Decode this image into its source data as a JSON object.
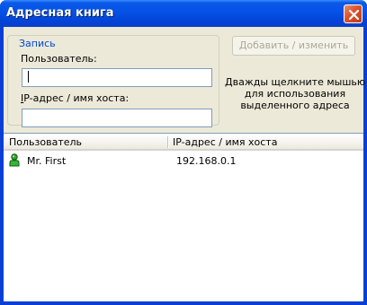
{
  "window": {
    "title": "Адресная книга"
  },
  "entry_group": {
    "legend": "Запись",
    "user_label": "Пользователь:",
    "ip_label_underlined": "I",
    "ip_label_rest": "P-адрес / имя хоста:",
    "user_value": "",
    "ip_value": ""
  },
  "add_button": {
    "label": "Добавить / изменить",
    "enabled": false
  },
  "hint": {
    "line1": "Дважды щелкните мышью",
    "line2": "для использования",
    "line3": "выделенного адреса"
  },
  "list": {
    "columns": [
      "Пользователь",
      "IP-адрес / имя хоста"
    ],
    "rows": [
      {
        "user": "Mr. First",
        "host": "192.168.0.1",
        "icon": "user-icon"
      }
    ]
  },
  "colors": {
    "titlebar": "#0551e6",
    "client_bg": "#ece9d8",
    "group_legend": "#0046d5",
    "disabled_text": "#aca899"
  }
}
